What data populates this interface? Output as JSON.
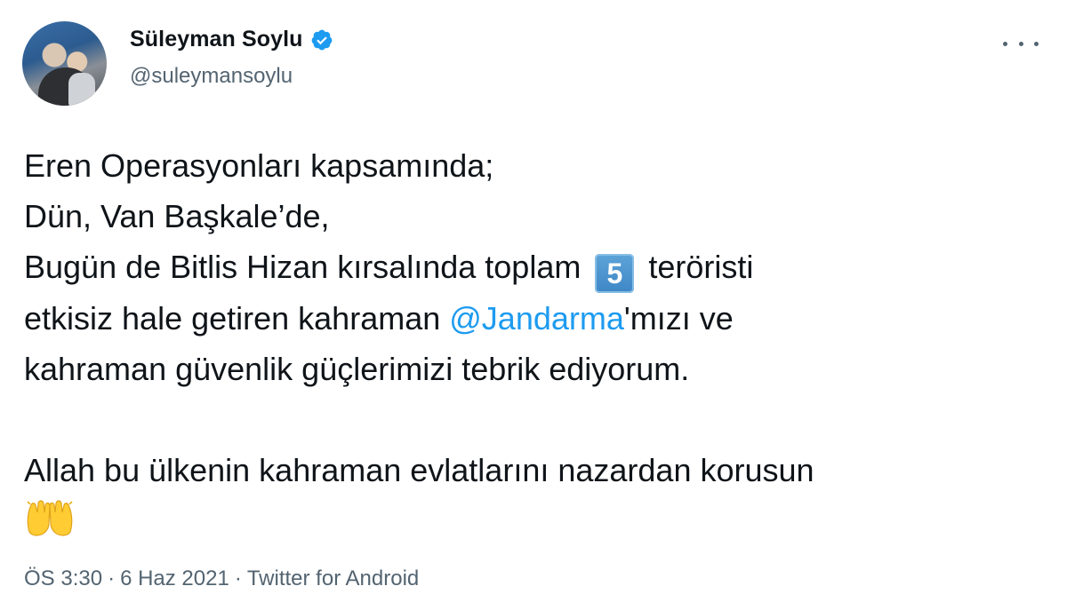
{
  "author": {
    "name": "Süleyman Soylu",
    "handle": "@suleymansoylu",
    "verified": true
  },
  "tweet": {
    "line1": "Eren Operasyonları kapsamında;",
    "line2": "Dün, Van Başkale’de,",
    "line3_before": "Bugün de Bitlis Hizan kırsalında toplam",
    "keycap_number": "5",
    "line3_after": "teröristi",
    "line4_before": "etkisiz hale getiren kahraman",
    "mention": "@Jandarma",
    "line4_after": "'mızı ve",
    "line5": "kahraman güvenlik güçlerimizi tebrik ediyorum.",
    "line6": "Allah bu ülkenin kahraman evlatlarını nazardan korusun",
    "emoji_icon": "raising-hands-icon"
  },
  "meta": {
    "time": "ÖS 3:30",
    "separator": "·",
    "date": "6 Haz 2021",
    "source": "Twitter for Android"
  },
  "colors": {
    "text": "#0f1419",
    "secondary": "#536471",
    "link": "#1d9bf0",
    "keycap": "#3d87c6"
  },
  "icons": {
    "verified": "verified-badge-icon",
    "more": "more-options-icon"
  }
}
